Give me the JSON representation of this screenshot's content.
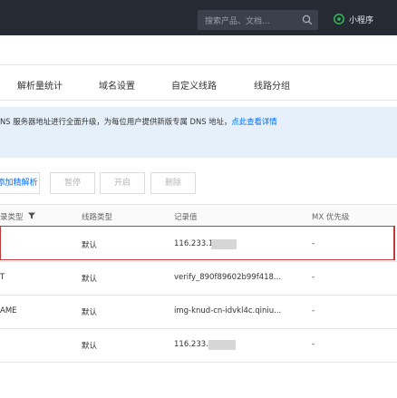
{
  "topbar": {
    "search_placeholder": "搜索产品、文档...",
    "mini_program_label": "小程序"
  },
  "tabs": [
    "解析量统计",
    "域名设置",
    "自定义线路",
    "线路分组"
  ],
  "notice": {
    "text": "NS 服务器地址进行全面升级，为每位用户提供新版专属 DNS 地址，",
    "link": "点此查看详情"
  },
  "toolbar": {
    "batch_label": "添加精解析",
    "pause_label": "暂停",
    "enable_label": "开启",
    "delete_label": "删除"
  },
  "table": {
    "headers": [
      "录类型",
      "线路类型",
      "记录值",
      "MX 优先级"
    ],
    "rows": [
      {
        "type": "",
        "line": "默认",
        "value": "116.233.1",
        "mx": "-"
      },
      {
        "type": "T",
        "line": "默认",
        "value": "verify_890f89602b99f418...",
        "mx": "-"
      },
      {
        "type": "AME",
        "line": "默认",
        "value": "img-knud-cn-idvkl4c.qiniu...",
        "mx": "-"
      },
      {
        "type": "",
        "line": "默认",
        "value": "116.233.1",
        "mx": "-"
      }
    ]
  },
  "colors": {
    "topbar_bg": "#252a33",
    "accent": "#006eff",
    "notice_bg": "#e5f0fb",
    "highlight": "#c03a3a"
  }
}
